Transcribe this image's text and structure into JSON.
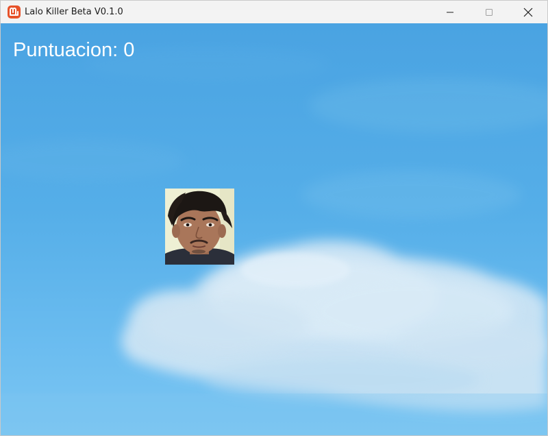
{
  "window": {
    "title": "Lalo Killer Beta V0.1.0",
    "icon": "monogame-logo-icon",
    "controls": [
      "minimize-icon",
      "maximize-icon",
      "close-icon"
    ]
  },
  "hud": {
    "score_text": "Puntuacion: 0"
  },
  "game": {
    "background": "sky-with-cloud",
    "sprite": "face-target",
    "colors": {
      "sky": "#55aee8",
      "cloud": "#d6e9f6",
      "score_text": "#ffffff",
      "app_icon": "#e7522a"
    }
  }
}
